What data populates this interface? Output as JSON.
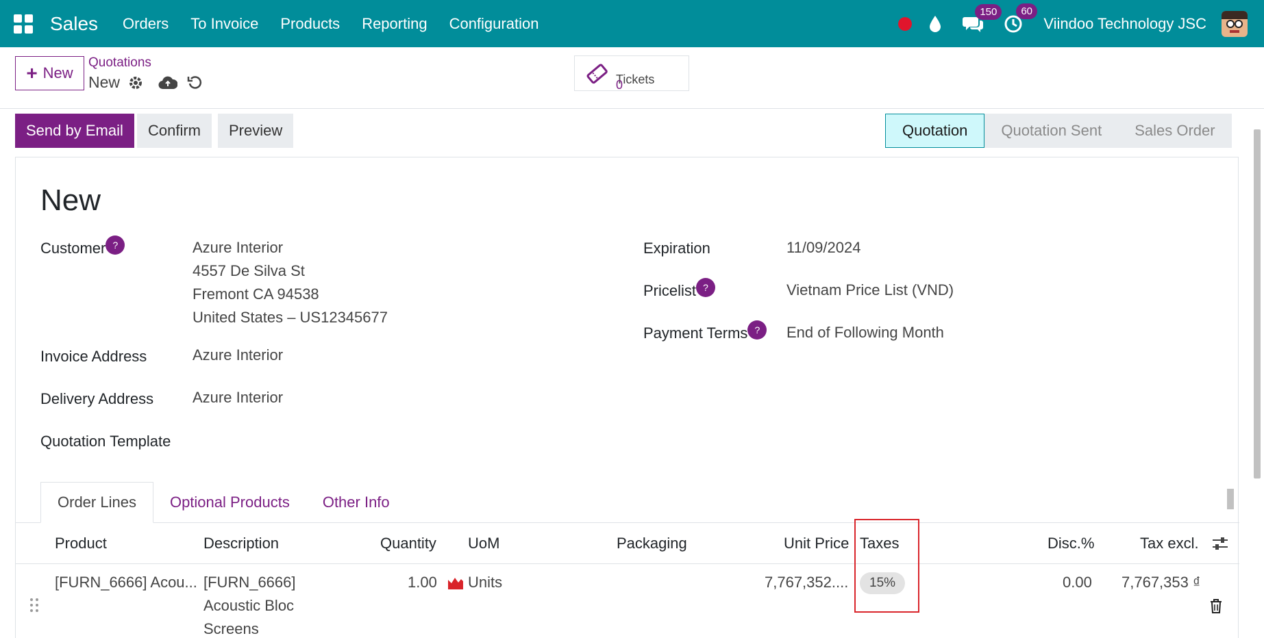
{
  "navbar": {
    "brand": "Sales",
    "menu": [
      "Orders",
      "To Invoice",
      "Products",
      "Reporting",
      "Configuration"
    ],
    "chat_badge": "150",
    "activity_badge": "60",
    "company": "Viindoo Technology JSC",
    "icons": [
      "apps-icon",
      "record-dot-icon",
      "drop-icon",
      "chat-icon",
      "clock-icon",
      "avatar"
    ]
  },
  "control_panel": {
    "new_label": "New",
    "breadcrumb": "Quotations",
    "record": "New",
    "smart_button": {
      "label": "Tickets",
      "value": "0"
    }
  },
  "statusbar": {
    "send_by_email": "Send by Email",
    "confirm": "Confirm",
    "preview": "Preview",
    "stages": [
      "Quotation",
      "Quotation Sent",
      "Sales Order"
    ],
    "active_stage": "Quotation"
  },
  "form": {
    "title": "New",
    "customer_label": "Customer",
    "customer_lines": [
      "Azure Interior",
      "4557 De Silva St",
      "Fremont CA 94538",
      "United States – US12345677"
    ],
    "invoice_address_label": "Invoice Address",
    "invoice_address": "Azure Interior",
    "delivery_address_label": "Delivery Address",
    "delivery_address": "Azure Interior",
    "quotation_template_label": "Quotation Template",
    "expiration_label": "Expiration",
    "expiration": "11/09/2024",
    "pricelist_label": "Pricelist",
    "pricelist": "Vietnam Price List (VND)",
    "payment_terms_label": "Payment Terms",
    "payment_terms": "End of Following Month",
    "help_mark": "?"
  },
  "notebook": {
    "tabs": [
      "Order Lines",
      "Optional Products",
      "Other Info"
    ],
    "columns": [
      "Product",
      "Description",
      "Quantity",
      "UoM",
      "Packaging",
      "Unit Price",
      "Taxes",
      "Disc.%",
      "Tax excl."
    ],
    "rows": [
      {
        "product": "[FURN_6666] Acou...",
        "description": [
          "[FURN_6666]",
          "Acoustic Bloc",
          "Screens"
        ],
        "quantity": "1.00",
        "uom": "Units",
        "packaging": "",
        "unit_price": "7,767,352....",
        "tax": "15%",
        "discount": "0.00",
        "tax_excl": "7,767,353 ₫"
      }
    ]
  },
  "colors": {
    "navbar": "#018d9a",
    "primary": "#7b1f84",
    "highlight": "#d9242a"
  }
}
